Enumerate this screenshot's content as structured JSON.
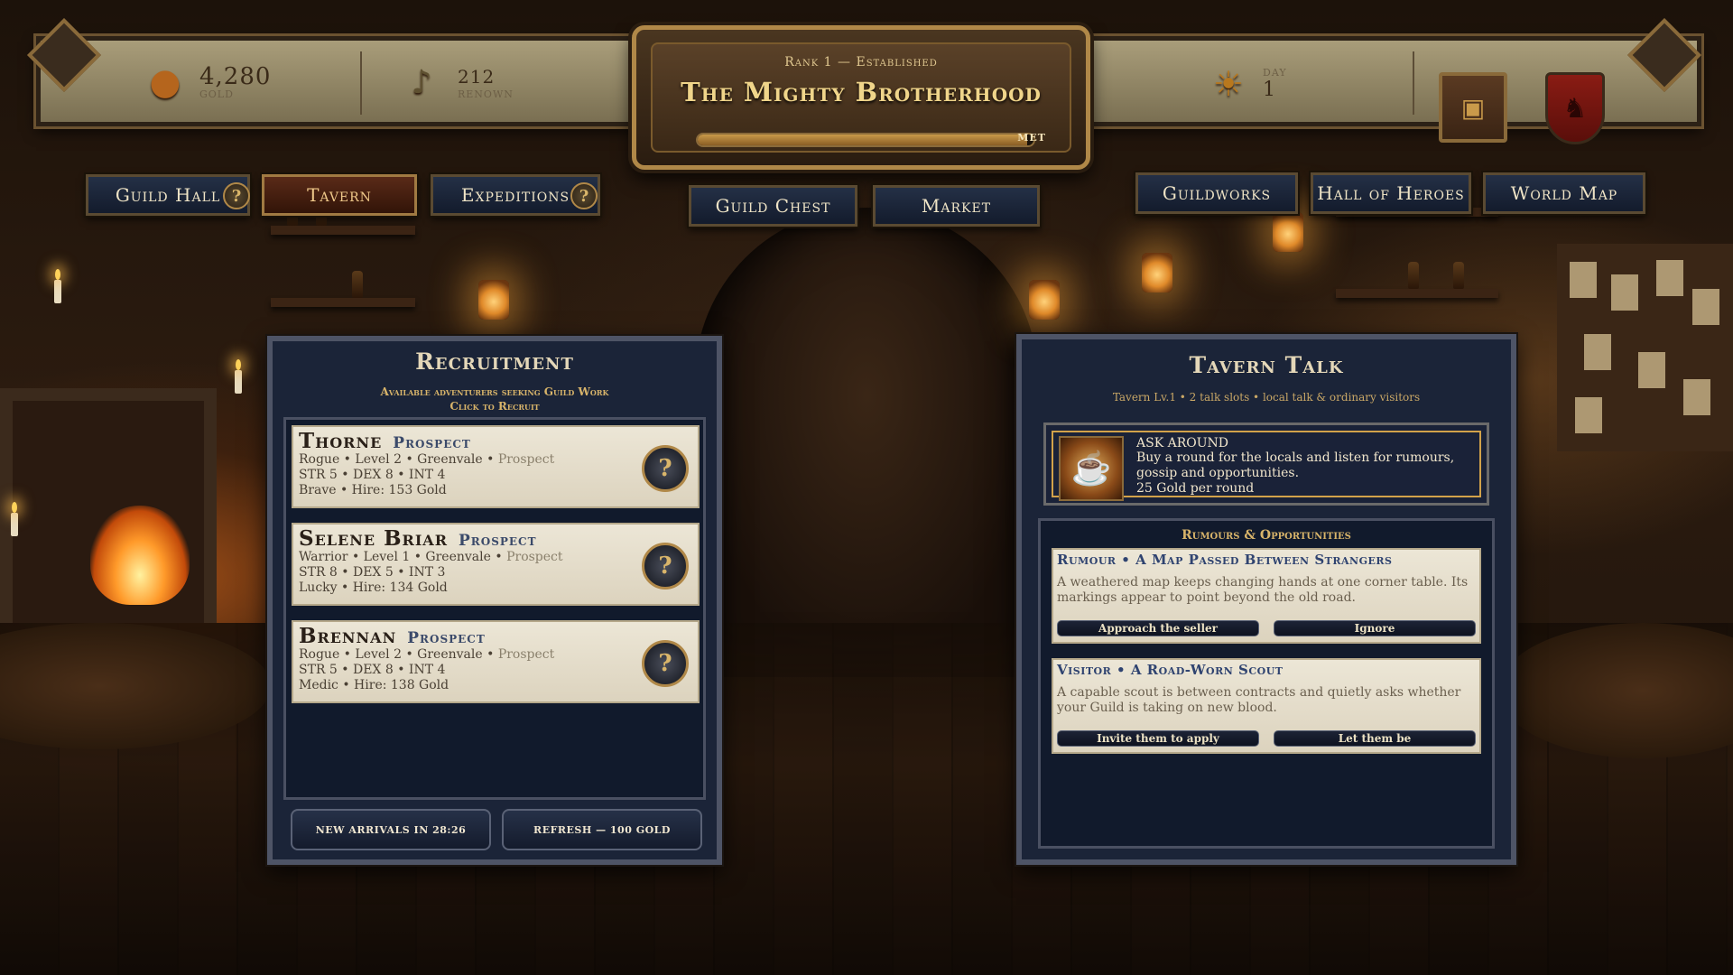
{
  "resources": {
    "gold": {
      "value": "4,280",
      "label": "GOLD"
    },
    "renown": {
      "value": "212",
      "label": "RENOWN"
    },
    "day": {
      "label": "DAY",
      "value": "1"
    }
  },
  "guild": {
    "rank": "Rank 1 — Established",
    "name": "The Mighty Brotherhood",
    "progress_label": "MET",
    "progress": 0.98
  },
  "nav": {
    "guild_hall": "Guild Hall",
    "tavern": "Tavern",
    "expeditions": "Expeditions",
    "guild_chest": "Guild Chest",
    "market": "Market",
    "guildworks": "Guildworks",
    "hall_of_heroes": "Hall of Heroes",
    "world_map": "World Map",
    "help_glyph": "?"
  },
  "recruitment": {
    "title": "Recruitment",
    "subtitle1": "Available adventurers seeking Guild Work",
    "subtitle2": "Click to Recruit",
    "recruits": [
      {
        "name": "Thorne",
        "tag": "Prospect",
        "line1": "Rogue • Level 2 • Greenvale • ",
        "line1_fade": "Prospect",
        "line2": "STR 5 • DEX 8 • INT 4",
        "line3": "Brave • Hire: 153 Gold"
      },
      {
        "name": "Selene Briar",
        "tag": "Prospect",
        "line1": "Warrior • Level 1 • Greenvale • ",
        "line1_fade": "Prospect",
        "line2": "STR 8 • DEX 5 • INT 3",
        "line3": "Lucky • Hire: 134 Gold"
      },
      {
        "name": "Brennan",
        "tag": "Prospect",
        "line1": "Rogue • Level 2 • Greenvale • ",
        "line1_fade": "Prospect",
        "line2": "STR 5 • DEX 8 • INT 4",
        "line3": "Medic • Hire: 138 Gold"
      }
    ],
    "new_arrivals": "New arrivals in 28:26",
    "refresh": "Refresh — 100 Gold"
  },
  "tavern_talk": {
    "title": "Tavern Talk",
    "subtitle": "Tavern Lv.1 • 2 talk slots • local talk & ordinary visitors",
    "ask": {
      "title": "ASK AROUND",
      "desc": "Buy a round for the locals and listen for rumours, gossip and opportunities.",
      "cost": "25 Gold per round"
    },
    "rumours_heading": "Rumours & Opportunities",
    "items": [
      {
        "title": "Rumour  •  A Map Passed Between Strangers",
        "desc": "A weathered map keeps changing hands at one corner table. Its markings appear to point beyond the old road.",
        "btn1": "Approach the seller",
        "btn2": "Ignore"
      },
      {
        "title": "Visitor  •  A Road-Worn Scout",
        "desc": "A capable scout is between contracts and quietly asks whether your Guild is taking on new blood.",
        "btn1": "Invite them to apply",
        "btn2": "Let them be"
      }
    ]
  },
  "icons": {
    "gold": "coin-pile-icon",
    "renown": "lyre-icon",
    "day": "sun-icon",
    "ledger": "book-icon",
    "crest": "lion-shield-icon",
    "ask": "ale-mug-icon"
  },
  "colors": {
    "accent_gold": "#d8b46a",
    "panel_navy": "#1b2438",
    "active_tab": "#5a2a18",
    "parchment": "#ece6d6"
  }
}
